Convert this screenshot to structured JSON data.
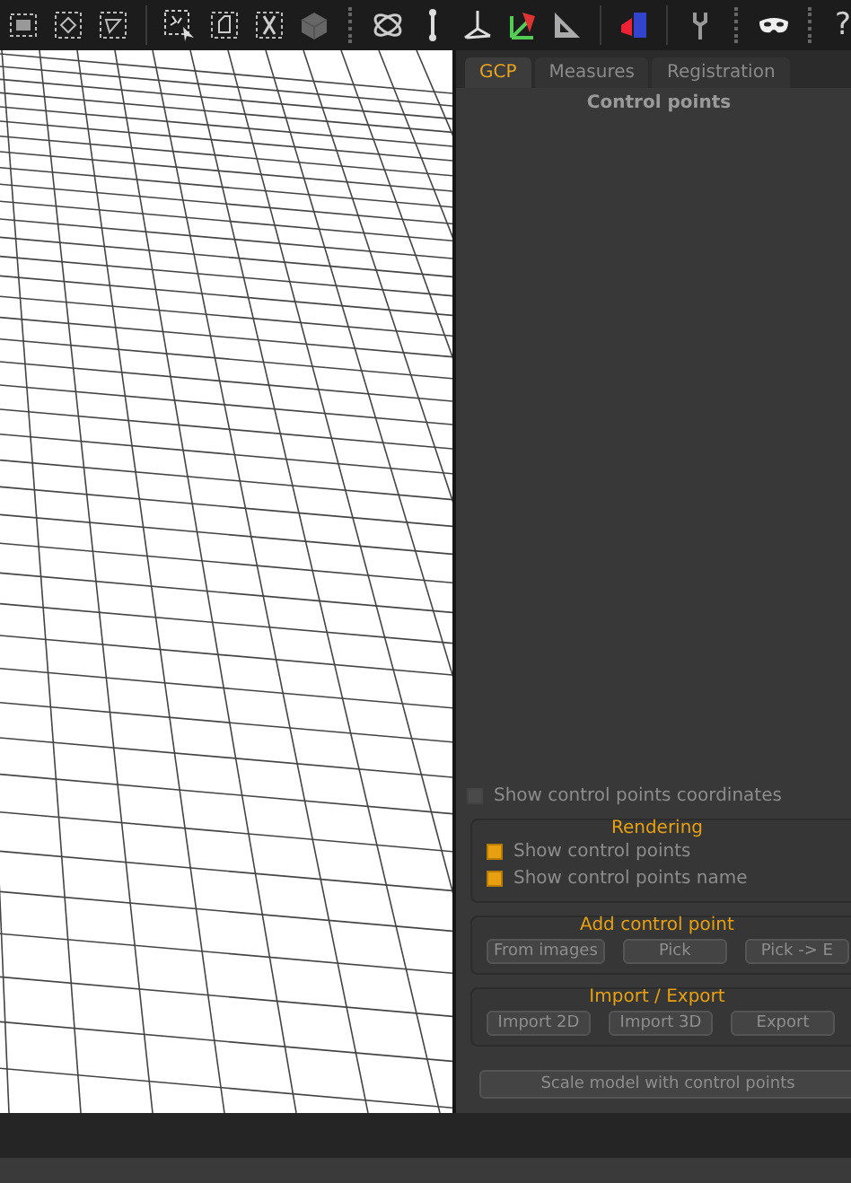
{
  "toolbar": {
    "help": "?"
  },
  "tabs": [
    {
      "label": "GCP",
      "selected": true
    },
    {
      "label": "Measures",
      "selected": false
    },
    {
      "label": "Registration",
      "selected": false
    }
  ],
  "panel": {
    "title": "Control points",
    "show_coordinates": {
      "label": "Show control points coordinates",
      "checked": false
    },
    "groups": [
      {
        "title": "Rendering",
        "kind": "checks",
        "items": [
          {
            "label": "Show control points",
            "checked": true
          },
          {
            "label": "Show control points name",
            "checked": true
          }
        ]
      },
      {
        "title": "Add control point",
        "kind": "buttons",
        "items": [
          {
            "label": "From images"
          },
          {
            "label": "Pick"
          },
          {
            "label": "Pick -> E"
          }
        ]
      },
      {
        "title": "Import / Export",
        "kind": "buttons",
        "items": [
          {
            "label": "Import 2D"
          },
          {
            "label": "Import 3D"
          },
          {
            "label": "Export"
          }
        ]
      }
    ],
    "scale_button": "Scale model with control points"
  }
}
